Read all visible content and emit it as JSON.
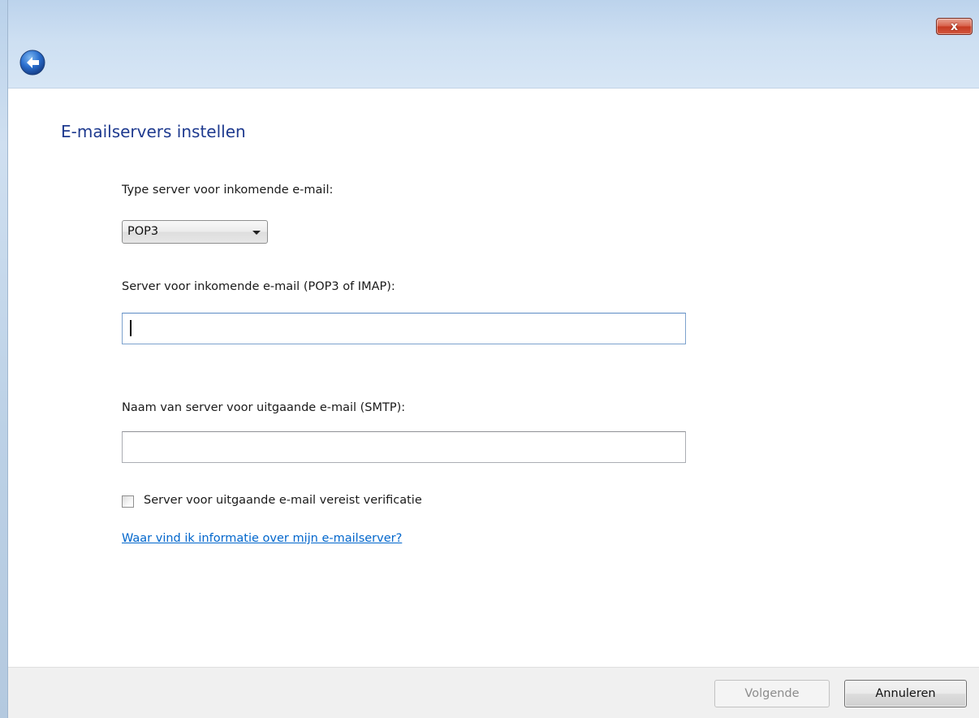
{
  "window": {
    "close_label": "x",
    "back_icon": "back-arrow-icon",
    "close_color": "#c63a22"
  },
  "page": {
    "title": "E-mailservers instellen"
  },
  "incoming_type": {
    "label": "Type server voor inkomende e-mail:",
    "selected": "POP3"
  },
  "incoming_server": {
    "label": "Server voor inkomende e-mail (POP3 of IMAP):",
    "value": ""
  },
  "outgoing_server": {
    "label": "Naam van server voor uitgaande e-mail (SMTP):",
    "value": ""
  },
  "auth_checkbox": {
    "label": "Server voor uitgaande e-mail vereist verificatie",
    "checked": false
  },
  "help_link": {
    "text": "Waar vind ik informatie over mijn e-mailserver?"
  },
  "footer": {
    "next_label": "Volgende",
    "cancel_label": "Annuleren"
  },
  "colors": {
    "title": "#1e3a8f",
    "link": "#0066cc"
  }
}
